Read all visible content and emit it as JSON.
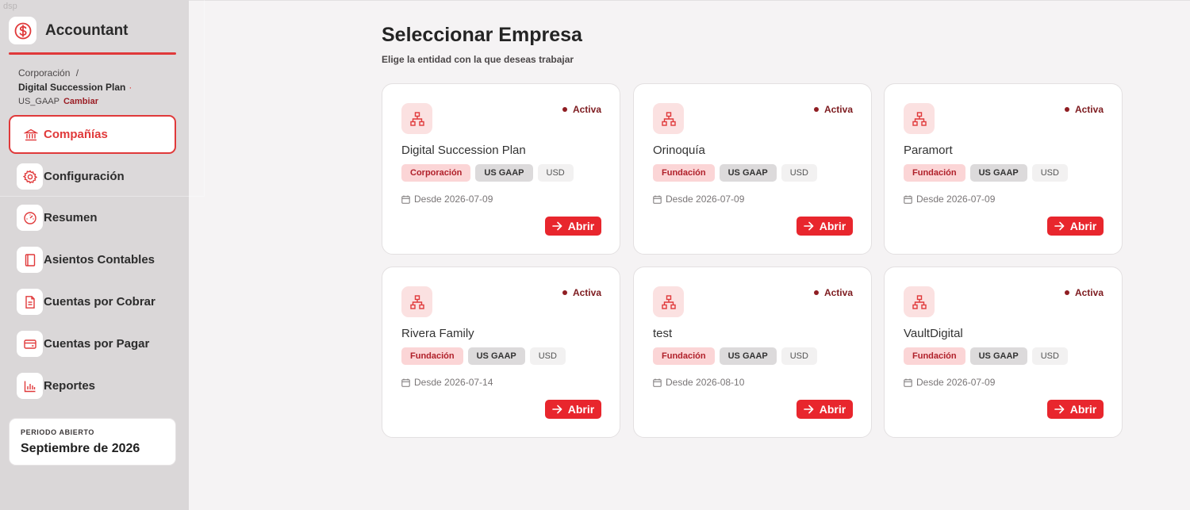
{
  "app": {
    "name": "Accountant",
    "ghost_text": "dsp",
    "breadcrumb": {
      "parent": "Corporación",
      "separator": "/",
      "entity": "Digital Succession Plan",
      "entity_dot": "·",
      "standard": "US_GAAP",
      "change_label": "Cambiar"
    },
    "accent_color": "#e0393a"
  },
  "sidebar": {
    "items": [
      {
        "label": "Compañías",
        "icon": "bank-icon",
        "active": true
      },
      {
        "label": "Configuración",
        "icon": "gear-icon",
        "active": false
      },
      {
        "label": "Resumen",
        "icon": "gauge-icon",
        "active": false
      },
      {
        "label": "Asientos Contables",
        "icon": "book-icon",
        "active": false
      },
      {
        "label": "Cuentas por Cobrar",
        "icon": "invoice-icon",
        "active": false
      },
      {
        "label": "Cuentas por Pagar",
        "icon": "wallet-icon",
        "active": false
      },
      {
        "label": "Reportes",
        "icon": "bar-chart-icon",
        "active": false
      }
    ],
    "period": {
      "label": "PERIODO ABIERTO",
      "value": "Septiembre de 2026"
    }
  },
  "main": {
    "title": "Seleccionar Empresa",
    "subtitle": "Elige la entidad con la que deseas trabajar",
    "companies": [
      {
        "name": "Digital Succession Plan",
        "status": "Activa",
        "type": "Corporación",
        "standard": "US GAAP",
        "currency": "USD",
        "since": "Desde 2026-07-09",
        "action": "Abrir"
      },
      {
        "name": "Orinoquía",
        "status": "Activa",
        "type": "Fundación",
        "standard": "US GAAP",
        "currency": "USD",
        "since": "Desde 2026-07-09",
        "action": "Abrir"
      },
      {
        "name": "Paramort",
        "status": "Activa",
        "type": "Fundación",
        "standard": "US GAAP",
        "currency": "USD",
        "since": "Desde 2026-07-09",
        "action": "Abrir"
      },
      {
        "name": "Rivera Family",
        "status": "Activa",
        "type": "Fundación",
        "standard": "US GAAP",
        "currency": "USD",
        "since": "Desde 2026-07-14",
        "action": "Abrir"
      },
      {
        "name": "test",
        "status": "Activa",
        "type": "Fundación",
        "standard": "US GAAP",
        "currency": "USD",
        "since": "Desde 2026-08-10",
        "action": "Abrir"
      },
      {
        "name": "VaultDigital",
        "status": "Activa",
        "type": "Fundación",
        "standard": "US GAAP",
        "currency": "USD",
        "since": "Desde 2026-07-09",
        "action": "Abrir"
      }
    ]
  }
}
